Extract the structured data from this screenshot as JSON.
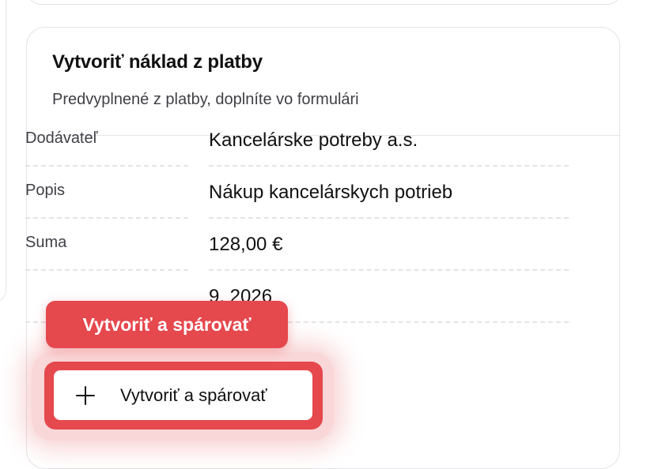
{
  "card": {
    "title": "Vytvoriť náklad z platby",
    "subtitle": "Predvyplnené z platby, doplníte vo formulári"
  },
  "fields": [
    {
      "label": "Dodávateľ",
      "value": "Kancelárske potreby a.s."
    },
    {
      "label": "Popis",
      "value": "Nákup kancelárskych potrieb"
    },
    {
      "label": "Suma",
      "value": "128,00 €"
    },
    {
      "label": "",
      "value": "9. 2026"
    }
  ],
  "tooltip": {
    "text": "Vytvoriť a spárovať"
  },
  "action": {
    "label": "Vytvoriť a spárovať",
    "icon": "plus-icon"
  },
  "colors": {
    "accent": "#e5484d",
    "border": "#e4e4e7",
    "muted_text": "#3f3f46"
  }
}
